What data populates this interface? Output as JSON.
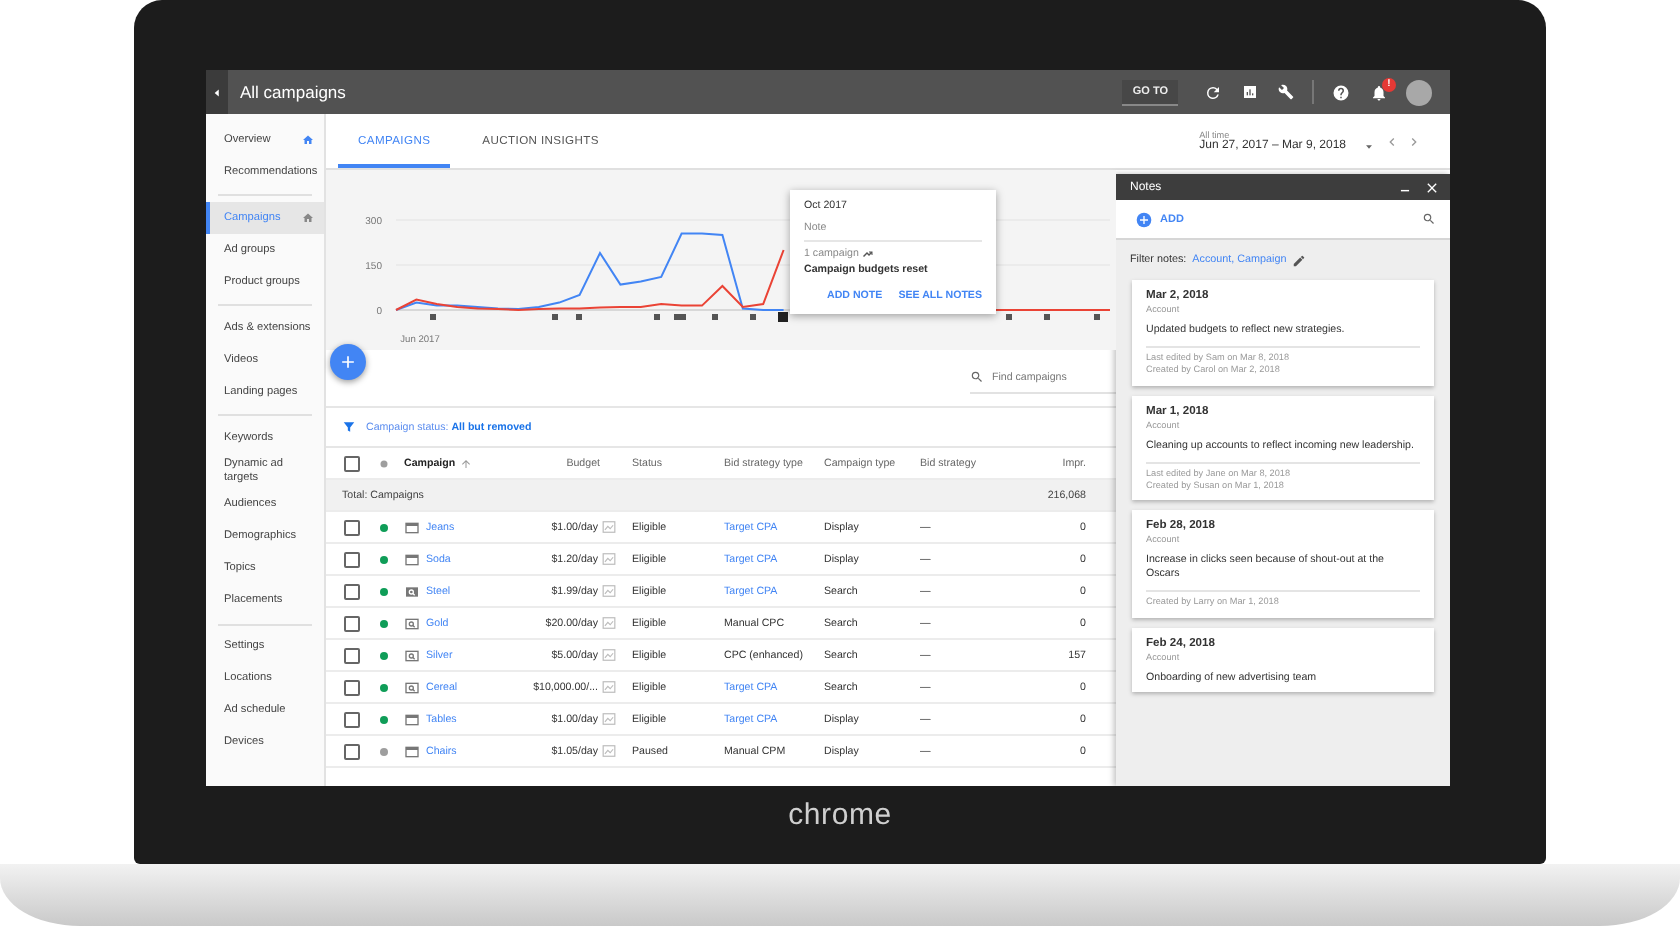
{
  "top_bar": {
    "title": "All campaigns",
    "goto": "GO TO",
    "notification_badge": "!"
  },
  "sidebar": {
    "groups": [
      {
        "items": [
          {
            "label": "Overview",
            "selected": false,
            "home_icon": true
          },
          {
            "label": "Recommendations",
            "selected": false,
            "home_icon": false
          }
        ]
      },
      {
        "items": [
          {
            "label": "Campaigns",
            "selected": true,
            "home_icon": true
          },
          {
            "label": "Ad groups",
            "selected": false,
            "home_icon": false
          },
          {
            "label": "Product groups",
            "selected": false,
            "home_icon": false
          }
        ]
      },
      {
        "items": [
          {
            "label": "Ads & extensions",
            "selected": false,
            "home_icon": false
          },
          {
            "label": "Videos",
            "selected": false,
            "home_icon": false
          },
          {
            "label": "Landing pages",
            "selected": false,
            "home_icon": false
          }
        ]
      },
      {
        "items": [
          {
            "label": "Keywords",
            "selected": false,
            "home_icon": false
          },
          {
            "label": "Dynamic ad targets",
            "selected": false,
            "home_icon": false
          },
          {
            "label": "Audiences",
            "selected": false,
            "home_icon": false
          },
          {
            "label": "Demographics",
            "selected": false,
            "home_icon": false
          },
          {
            "label": "Topics",
            "selected": false,
            "home_icon": false
          },
          {
            "label": "Placements",
            "selected": false,
            "home_icon": false
          }
        ]
      },
      {
        "items": [
          {
            "label": "Settings",
            "selected": false,
            "home_icon": false
          },
          {
            "label": "Locations",
            "selected": false,
            "home_icon": false
          },
          {
            "label": "Ad schedule",
            "selected": false,
            "home_icon": false
          },
          {
            "label": "Devices",
            "selected": false,
            "home_icon": false
          }
        ]
      }
    ]
  },
  "tabs": [
    {
      "label": "CAMPAIGNS",
      "selected": true
    },
    {
      "label": "AUCTION INSIGHTS",
      "selected": false
    }
  ],
  "date_range": {
    "label": "All time",
    "value": "Jun 27, 2017 – Mar 9, 2018"
  },
  "chart": {
    "chart_data": {
      "type": "line",
      "ylim": [
        0,
        300
      ],
      "yticks": [
        0,
        150,
        300
      ],
      "series": [
        {
          "color": "#4285f4",
          "values": [
            0,
            25,
            15,
            15,
            10,
            5,
            3,
            10,
            25,
            50,
            190,
            85,
            95,
            110,
            255,
            255,
            250,
            5,
            0,
            0
          ]
        },
        {
          "color": "#ea4335",
          "values": [
            0,
            35,
            20,
            10,
            5,
            3,
            0,
            3,
            5,
            5,
            8,
            10,
            10,
            20,
            15,
            15,
            80,
            10,
            20,
            200
          ]
        }
      ]
    },
    "start_label": "Jun 2017",
    "popup": {
      "date": "Oct 2017",
      "heading": "Note",
      "scope": "1 campaign",
      "text": "Campaign budgets reset",
      "actions": [
        "ADD NOTE",
        "SEE ALL NOTES"
      ]
    }
  },
  "search": {
    "placeholder": "Find campaigns"
  },
  "filter": {
    "text": "Campaign status: **All but removed**"
  },
  "table": {
    "all_checked": false,
    "columns": [
      {
        "label": "Campaign",
        "sorted": true
      },
      {
        "label": "Budget",
        "sorted": false
      },
      {
        "label": "Status",
        "sorted": false
      },
      {
        "label": "Bid strategy type",
        "sorted": false
      },
      {
        "label": "Campaign type",
        "sorted": false
      },
      {
        "label": "Bid strategy",
        "sorted": false
      },
      {
        "label": "Impr.",
        "sorted": false
      }
    ],
    "total": {
      "label": "Total: Campaigns",
      "impr": "216,068"
    },
    "rows": [
      {
        "checked": false,
        "color": "#0f9d58",
        "kind": "display",
        "name": "Jeans",
        "budget": "$1.00/day",
        "status": "Eligible",
        "bid_strategy_type": "Target CPA",
        "bid_strategy_linked": true,
        "campaign_type": "Display",
        "bid_strategy": "—",
        "impr": "0"
      },
      {
        "checked": false,
        "color": "#0f9d58",
        "kind": "display",
        "name": "Soda",
        "budget": "$1.20/day",
        "status": "Eligible",
        "bid_strategy_type": "Target CPA",
        "bid_strategy_linked": true,
        "campaign_type": "Display",
        "bid_strategy": "—",
        "impr": "0"
      },
      {
        "checked": false,
        "color": "#0f9d58",
        "kind": "search-dark",
        "name": "Steel",
        "budget": "$1.99/day",
        "status": "Eligible",
        "bid_strategy_type": "Target CPA",
        "bid_strategy_linked": true,
        "campaign_type": "Search",
        "bid_strategy": "—",
        "impr": "0"
      },
      {
        "checked": false,
        "color": "#0f9d58",
        "kind": "search",
        "name": "Gold",
        "budget": "$20.00/day",
        "status": "Eligible",
        "bid_strategy_type": "Manual CPC",
        "bid_strategy_linked": false,
        "campaign_type": "Search",
        "bid_strategy": "—",
        "impr": "0"
      },
      {
        "checked": false,
        "color": "#0f9d58",
        "kind": "search",
        "name": "Silver",
        "budget": "$5.00/day",
        "status": "Eligible",
        "bid_strategy_type": "CPC (enhanced)",
        "bid_strategy_linked": false,
        "campaign_type": "Search",
        "bid_strategy": "—",
        "impr": "157"
      },
      {
        "checked": false,
        "color": "#0f9d58",
        "kind": "search",
        "name": "Cereal",
        "budget": "$10,000.00/...",
        "status": "Eligible",
        "bid_strategy_type": "Target CPA",
        "bid_strategy_linked": true,
        "campaign_type": "Search",
        "bid_strategy": "—",
        "impr": "0"
      },
      {
        "checked": false,
        "color": "#0f9d58",
        "kind": "display",
        "name": "Tables",
        "budget": "$1.00/day",
        "status": "Eligible",
        "bid_strategy_type": "Target CPA",
        "bid_strategy_linked": true,
        "campaign_type": "Display",
        "bid_strategy": "—",
        "impr": "0"
      },
      {
        "checked": false,
        "color": "#9e9e9e",
        "kind": "display",
        "name": "Chairs",
        "budget": "$1.05/day",
        "status": "Paused",
        "bid_strategy_type": "Manual CPM",
        "bid_strategy_linked": false,
        "campaign_type": "Display",
        "bid_strategy": "—",
        "impr": "0"
      }
    ]
  },
  "notes": {
    "title": "Notes",
    "add": "ADD",
    "filter_label": "Filter notes:",
    "filter_value": "Account, Campaign",
    "items": [
      {
        "date": "Mar 2, 2018",
        "scope": "Account",
        "text": "Updated budgets to reflect new strategies.",
        "meta": [
          "Last edited by Sam on Mar 8, 2018",
          "Created by Carol on Mar 2, 2018"
        ]
      },
      {
        "date": "Mar 1, 2018",
        "scope": "Account",
        "text": "Cleaning up accounts to reflect incoming new leadership.",
        "meta": [
          "Last edited by Jane on Mar 8, 2018",
          "Created by Susan on Mar 1, 2018"
        ]
      },
      {
        "date": "Feb 28, 2018",
        "scope": "Account",
        "text": "Increase in clicks seen because of shout-out at the Oscars",
        "meta": [
          "Created by Larry on Mar 1, 2018"
        ]
      },
      {
        "date": "Feb 24, 2018",
        "scope": "Account",
        "text": "Onboarding of new advertising team"
      }
    ]
  },
  "device": {
    "brand": "chrome"
  }
}
